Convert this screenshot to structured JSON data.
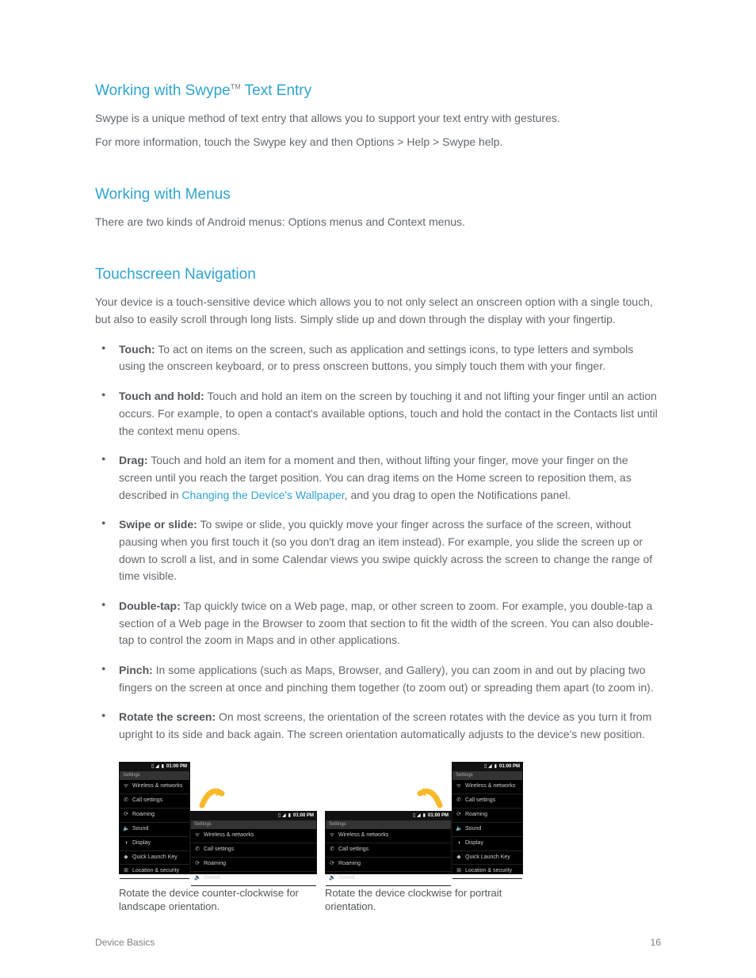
{
  "section1": {
    "title_pre": "Working with Swype",
    "tm": "TM",
    "title_post": " Text Entry",
    "p1": "Swype is a unique method of text entry that allows you to support your text entry with gestures.",
    "p2": "For more information, touch the Swype key and then Options > Help > Swype help."
  },
  "section2": {
    "title": "Working with Menus",
    "p1": "There are two kinds of Android menus: Options menus and Context menus."
  },
  "section3": {
    "title": "Touchscreen Navigation",
    "intro": "Your device is a touch-sensitive device which allows you to not only select an onscreen option with a single touch, but also to easily scroll through long lists. Simply slide up and down through the display with your fingertip.",
    "bullets": [
      {
        "lead": "Touch:",
        "text": " To act on items on the screen, such as application and settings icons, to type letters and symbols using the onscreen keyboard, or to press onscreen buttons, you simply touch them with your finger."
      },
      {
        "lead": "Touch and hold:",
        "text": " Touch and hold an item on the screen by touching it and not lifting your finger until an action occurs. For example, to open a contact's available options, touch and hold the contact in the Contacts list until the context menu opens."
      },
      {
        "lead": "Drag:",
        "text_pre": " Touch and hold an item for a moment and then, without lifting your finger, move your finger on the screen until you reach the target position. You can drag items on the Home screen to reposition them, as described in ",
        "link": "Changing the Device's Wallpaper",
        "text_post": ", and you drag to open the Notifications panel."
      },
      {
        "lead": "Swipe or slide:",
        "text": " To swipe or slide, you quickly move your finger across the surface of the screen, without pausing when you first touch it (so you don't drag an item instead). For example, you slide the screen up or down to scroll a list, and in some Calendar views you swipe quickly across the screen to change the range of time visible."
      },
      {
        "lead": "Double-tap:",
        "text": " Tap quickly twice on a Web page, map, or other screen to zoom. For example, you double-tap a section of a Web page in the Browser to zoom that section to fit the width of the screen. You can also double-tap to control the zoom in Maps and in other applications."
      },
      {
        "lead": "Pinch:",
        "text": " In some applications (such as Maps, Browser, and Gallery), you can zoom in and out by placing two fingers on the screen at once and pinching them together (to zoom out) or spreading them apart (to zoom in)."
      },
      {
        "lead": "Rotate the screen:",
        "text": " On most screens, the orientation of the screen rotates with the device as you turn it from upright to its side and back again. The screen orientation automatically adjusts to the device's new position."
      }
    ]
  },
  "phone": {
    "status_signal": "▯ ◢",
    "status_batt": "▮",
    "status_time": "01:00 PM",
    "header": "Settings",
    "rows": [
      {
        "icon": "ᯤ",
        "label": "Wireless & networks"
      },
      {
        "icon": "✆",
        "label": "Call settings"
      },
      {
        "icon": "⟳",
        "label": "Roaming"
      },
      {
        "icon": "🔈",
        "label": "Sound"
      },
      {
        "icon": "◑",
        "label": "Display"
      },
      {
        "icon": "◆",
        "label": "Quick Launch Key"
      },
      {
        "icon": "⊞",
        "label": "Location & security"
      }
    ]
  },
  "captions": {
    "left": "Rotate the device counter-clockwise for landscape orientation.",
    "right": "Rotate the device clockwise for portrait orientation."
  },
  "footer": {
    "label": "Device Basics",
    "page": "16"
  },
  "colors": {
    "accent": "#2ea4d0"
  }
}
